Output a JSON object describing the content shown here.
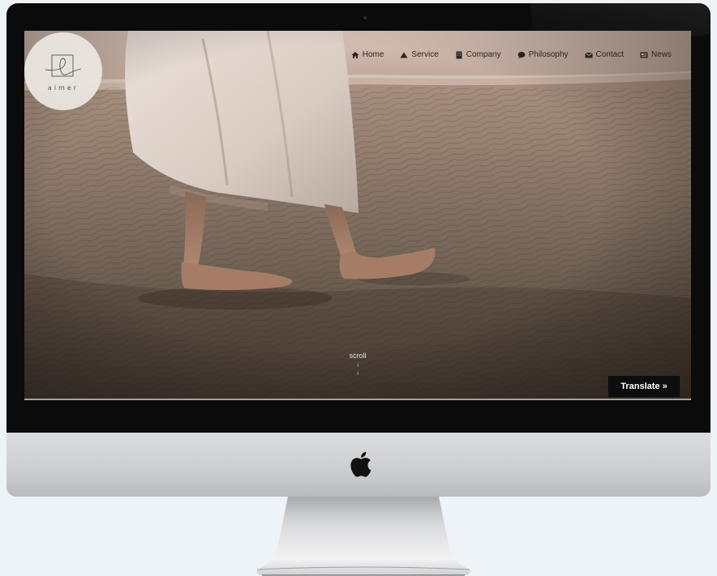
{
  "brand": {
    "name": "aimer"
  },
  "nav": {
    "items": [
      {
        "label": "Home",
        "icon": "home-icon"
      },
      {
        "label": "Service",
        "icon": "triangle-icon"
      },
      {
        "label": "Company",
        "icon": "building-icon"
      },
      {
        "label": "Philosophy",
        "icon": "speech-bubble-icon"
      },
      {
        "label": "Contact",
        "icon": "envelope-icon"
      },
      {
        "label": "News",
        "icon": "newspaper-icon"
      }
    ]
  },
  "hero": {
    "scroll_label": "scroll",
    "scroll_arrow": "↓"
  },
  "translate": {
    "label": "Translate »"
  },
  "colors": {
    "bezel": "#0b0b0c",
    "chin": "#c9cacd",
    "background": "#eef3f8",
    "translate_bg": "#0d0d0d"
  }
}
